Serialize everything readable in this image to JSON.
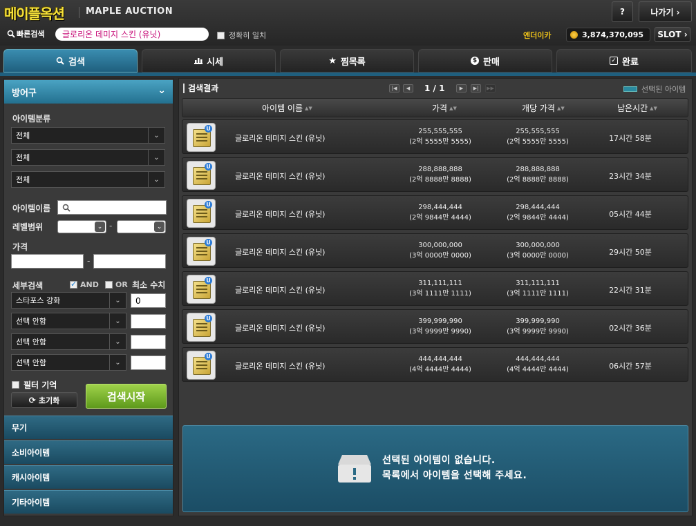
{
  "header": {
    "logo": "메이플옥션",
    "subtitle": "MAPLE AUCTION",
    "help_label": "?",
    "exit_label": "나가기 ›",
    "quick_search_label": "빠른검색",
    "quick_search_value": "글로리온 데미지 스킨 (유닛)",
    "exact_match_label": "정확히 일치",
    "server_name": "엔더이카",
    "meso": "3,874,370,095",
    "slot_label": "SLOT ›"
  },
  "tabs": [
    {
      "label": "검색",
      "icon": "search-icon",
      "active": true
    },
    {
      "label": "시세",
      "icon": "bar-chart-icon"
    },
    {
      "label": "찜목록",
      "icon": "star-icon"
    },
    {
      "label": "판매",
      "icon": "dollar-coin-icon"
    },
    {
      "label": "완료",
      "icon": "check-box-icon"
    }
  ],
  "sidebar": {
    "category_title": "방어구",
    "item_class_label": "아이템분류",
    "class_selects": [
      "전체",
      "전체",
      "전체"
    ],
    "item_name_label": "아이템이름",
    "level_range_label": "레벨범위",
    "range_dash": "-",
    "price_label": "가격",
    "detail_search_label": "세부검색",
    "and_label": "AND",
    "or_label": "OR",
    "min_value_label": "최소 수치",
    "detail_rows": [
      {
        "option": "스타포스 강화",
        "value": "0"
      },
      {
        "option": "선택 안함",
        "value": ""
      },
      {
        "option": "선택 안함",
        "value": ""
      },
      {
        "option": "선택 안함",
        "value": ""
      }
    ],
    "filter_memory_label": "필터 기억",
    "reset_label": "초기화",
    "search_start_label": "검색시작",
    "categories": [
      "무기",
      "소비아이템",
      "캐시아이템",
      "기타아이템"
    ]
  },
  "results": {
    "title": "검색결과",
    "page": "1 / 1",
    "legend_label": "선택된 아이템",
    "columns": [
      "아이템 이름",
      "가격",
      "개당 가격",
      "남은시간"
    ],
    "rows": [
      {
        "name": "글로리온 데미지 스킨 (유닛)",
        "price": "255,555,555",
        "price_kr": "(2억 5555만 5555)",
        "unit": "255,555,555",
        "unit_kr": "(2억 5555만 5555)",
        "time": "17시간 58분"
      },
      {
        "name": "글로리온 데미지 스킨 (유닛)",
        "price": "288,888,888",
        "price_kr": "(2억 8888만 8888)",
        "unit": "288,888,888",
        "unit_kr": "(2억 8888만 8888)",
        "time": "23시간 34분"
      },
      {
        "name": "글로리온 데미지 스킨 (유닛)",
        "price": "298,444,444",
        "price_kr": "(2억 9844만 4444)",
        "unit": "298,444,444",
        "unit_kr": "(2억 9844만 4444)",
        "time": "05시간 44분"
      },
      {
        "name": "글로리온 데미지 스킨 (유닛)",
        "price": "300,000,000",
        "price_kr": "(3억 0000만 0000)",
        "unit": "300,000,000",
        "unit_kr": "(3억 0000만 0000)",
        "time": "29시간 50분"
      },
      {
        "name": "글로리온 데미지 스킨 (유닛)",
        "price": "311,111,111",
        "price_kr": "(3억 1111만 1111)",
        "unit": "311,111,111",
        "unit_kr": "(3억 1111만 1111)",
        "time": "22시간 31분"
      },
      {
        "name": "글로리온 데미지 스킨 (유닛)",
        "price": "399,999,990",
        "price_kr": "(3억 9999만 9990)",
        "unit": "399,999,990",
        "unit_kr": "(3억 9999만 9990)",
        "time": "02시간 36분"
      },
      {
        "name": "글로리온 데미지 스킨 (유닛)",
        "price": "444,444,444",
        "price_kr": "(4억 4444만 4444)",
        "unit": "444,444,444",
        "unit_kr": "(4억 4444만 4444)",
        "time": "06시간 57분"
      }
    ],
    "empty_line1": "선택된 아이템이 없습니다.",
    "empty_line2": "목록에서 아이템을 선택해 주세요."
  }
}
